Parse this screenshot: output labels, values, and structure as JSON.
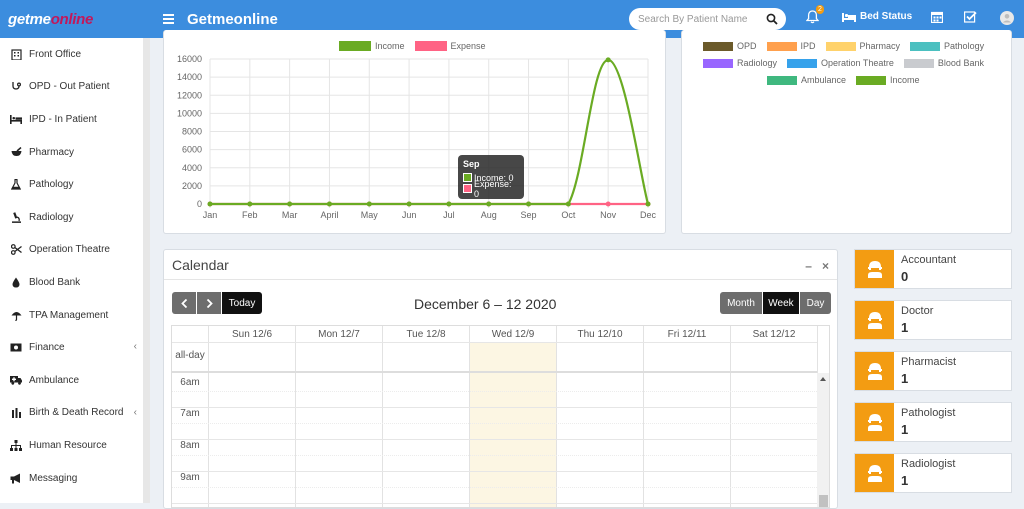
{
  "brand": {
    "logo_part1": "getme",
    "logo_part2": "online"
  },
  "header": {
    "title": "Getmeonline",
    "search_placeholder": "Search By Patient Name",
    "notification_count": "2",
    "bed_status_label": "Bed Status"
  },
  "sidebar": {
    "items": [
      {
        "label": "Front Office",
        "icon": "building-icon"
      },
      {
        "label": "OPD - Out Patient",
        "icon": "stethoscope-icon"
      },
      {
        "label": "IPD - In Patient",
        "icon": "bed-icon"
      },
      {
        "label": "Pharmacy",
        "icon": "mortar-pestle-icon"
      },
      {
        "label": "Pathology",
        "icon": "flask-icon"
      },
      {
        "label": "Radiology",
        "icon": "microscope-icon"
      },
      {
        "label": "Operation Theatre",
        "icon": "scissors-icon"
      },
      {
        "label": "Blood Bank",
        "icon": "drop-icon"
      },
      {
        "label": "TPA Management",
        "icon": "umbrella-icon"
      },
      {
        "label": "Finance",
        "icon": "money-icon",
        "expandable": true
      },
      {
        "label": "Ambulance",
        "icon": "ambulance-icon"
      },
      {
        "label": "Birth & Death Record",
        "icon": "birth-death-icon",
        "expandable": true
      },
      {
        "label": "Human Resource",
        "icon": "sitemap-icon"
      },
      {
        "label": "Messaging",
        "icon": "bullhorn-icon"
      }
    ]
  },
  "income_chart": {
    "legend": [
      {
        "label": "Income",
        "color": "#6aab23"
      },
      {
        "label": "Expense",
        "color": "#ff6384"
      }
    ],
    "tooltip": {
      "title": "Sep",
      "income_line": "Income: 0",
      "expense_line": "Expense: 0"
    }
  },
  "chart_data": {
    "type": "line",
    "categories": [
      "Jan",
      "Feb",
      "Mar",
      "April",
      "May",
      "Jun",
      "Jul",
      "Aug",
      "Sep",
      "Oct",
      "Nov",
      "Dec"
    ],
    "series": [
      {
        "name": "Income",
        "color": "#6aab23",
        "values": [
          0,
          0,
          0,
          0,
          0,
          0,
          0,
          0,
          0,
          0,
          15900,
          0
        ]
      },
      {
        "name": "Expense",
        "color": "#ff6384",
        "values": [
          0,
          0,
          0,
          0,
          0,
          0,
          0,
          0,
          0,
          0,
          0,
          0
        ]
      }
    ],
    "yticks": [
      "16000",
      "14000",
      "12000",
      "10000",
      "8000",
      "6000",
      "4000",
      "2000",
      "0"
    ],
    "ylim": [
      0,
      16000
    ],
    "title": "",
    "xlabel": "",
    "ylabel": "",
    "grid": true,
    "legend_position": "top"
  },
  "right_legend": {
    "items": [
      {
        "label": "OPD",
        "color": "#6b5a2a"
      },
      {
        "label": "IPD",
        "color": "#ffa04d"
      },
      {
        "label": "Pharmacy",
        "color": "#ffd26b"
      },
      {
        "label": "Pathology",
        "color": "#4bc0c0"
      },
      {
        "label": "Radiology",
        "color": "#9966ff"
      },
      {
        "label": "Operation Theatre",
        "color": "#36a2eb"
      },
      {
        "label": "Blood Bank",
        "color": "#c9cbcf"
      },
      {
        "label": "Ambulance",
        "color": "#3fb87f"
      },
      {
        "label": "Income",
        "color": "#6aab23"
      }
    ]
  },
  "calendar": {
    "panel_title": "Calendar",
    "minimize": "–",
    "close": "×",
    "today_label": "Today",
    "range_title": "December 6 – 12 2020",
    "views": {
      "month": "Month",
      "week": "Week",
      "day": "Day"
    },
    "all_day_label": "all-day",
    "days": [
      "Sun 12/6",
      "Mon 12/7",
      "Tue 12/8",
      "Wed 12/9",
      "Thu 12/10",
      "Fri 12/11",
      "Sat 12/12"
    ],
    "times": [
      "6am",
      "7am",
      "8am",
      "9am"
    ]
  },
  "staff": [
    {
      "role": "Accountant",
      "count": "0"
    },
    {
      "role": "Doctor",
      "count": "1"
    },
    {
      "role": "Pharmacist",
      "count": "1"
    },
    {
      "role": "Pathologist",
      "count": "1"
    },
    {
      "role": "Radiologist",
      "count": "1"
    }
  ],
  "colors": {
    "primary": "#3c8dde",
    "accent": "#f39c12",
    "today_highlight": "#fcf6e3"
  }
}
